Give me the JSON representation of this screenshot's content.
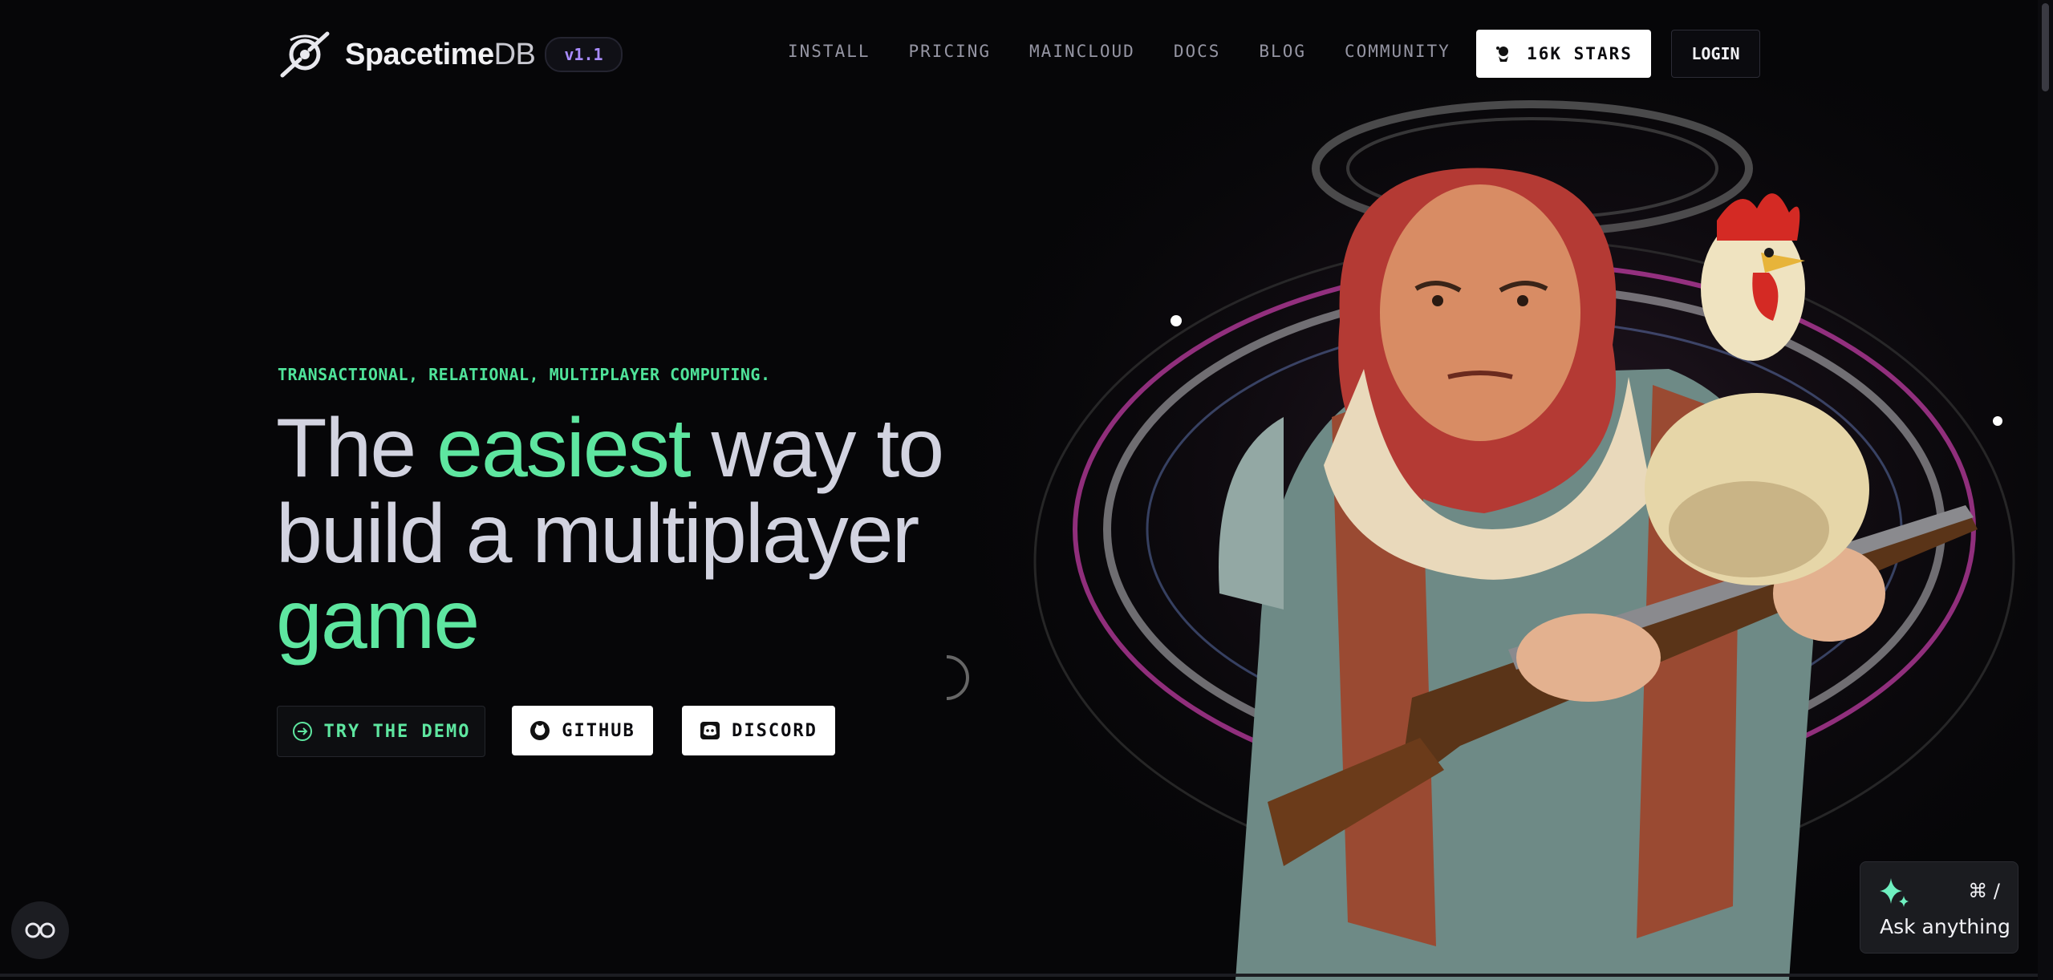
{
  "header": {
    "brand_bold": "Spacetime",
    "brand_light": "DB",
    "version": "v1.1",
    "nav": [
      "INSTALL",
      "PRICING",
      "MAINCLOUD",
      "DOCS",
      "BLOG",
      "COMMUNITY"
    ],
    "stars_label": "16K STARS",
    "login_label": "LOGIN"
  },
  "hero": {
    "tagline": "TRANSACTIONAL, RELATIONAL, MULTIPLAYER COMPUTING.",
    "headline": {
      "part1": "The ",
      "highlight1": "easiest",
      "part2": " way to build a multiplayer ",
      "highlight2": "game"
    },
    "cta_demo": "TRY THE DEMO",
    "cta_github": "GITHUB",
    "cta_discord": "DISCORD"
  },
  "ask": {
    "shortcut": "⌘ /",
    "label": "Ask anything"
  },
  "colors": {
    "background": "#060608",
    "accent_green": "#5ee6a0",
    "version_purple": "#a98cff",
    "heading_gray": "#d2d3e0"
  },
  "icons": [
    "spacetimedb-logo-icon",
    "github-star-icon",
    "arrow-right-circle-icon",
    "github-icon",
    "discord-icon",
    "sparkle-icon",
    "accessibility-icon"
  ]
}
